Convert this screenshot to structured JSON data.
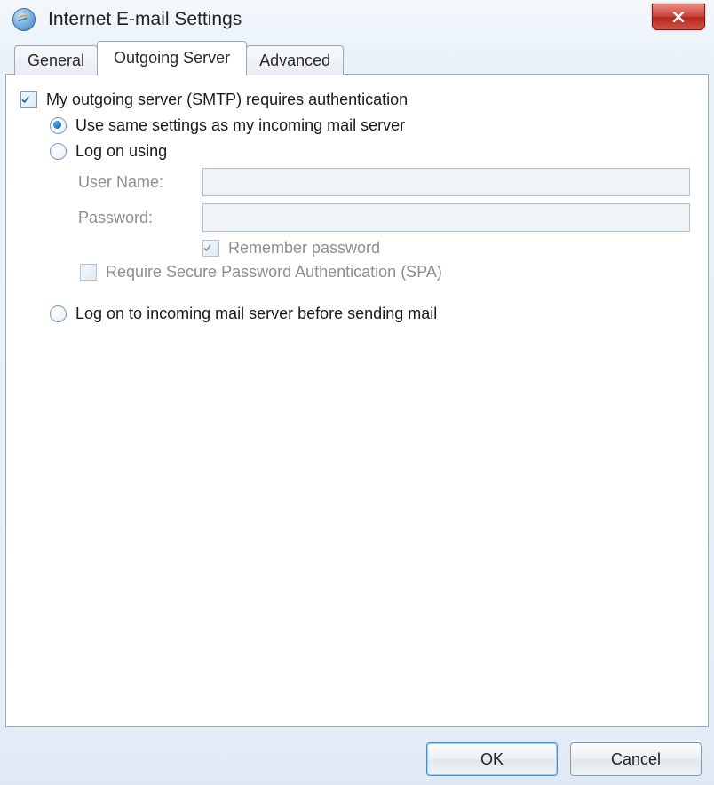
{
  "window": {
    "title": "Internet E-mail Settings"
  },
  "tabs": {
    "general": "General",
    "outgoing": "Outgoing Server",
    "advanced": "Advanced"
  },
  "options": {
    "requires_auth": "My outgoing server (SMTP) requires authentication",
    "use_same": "Use same settings as my incoming mail server",
    "log_on_using": "Log on using",
    "user_name_label": "User Name:",
    "password_label": "Password:",
    "remember_password": "Remember password",
    "require_spa": "Require Secure Password Authentication (SPA)",
    "log_on_incoming": "Log on to incoming mail server before sending mail",
    "user_name_value": "",
    "password_value": ""
  },
  "buttons": {
    "ok": "OK",
    "cancel": "Cancel"
  }
}
